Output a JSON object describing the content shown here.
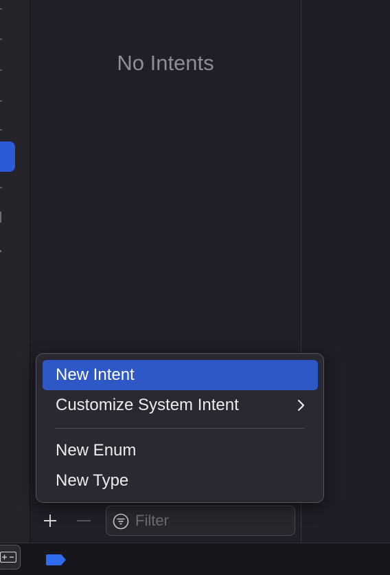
{
  "list": {
    "empty_label": "No Intents"
  },
  "add_menu": {
    "items": [
      {
        "label": "New Intent",
        "highlighted": true
      },
      {
        "label": "Customize System Intent",
        "has_submenu": true
      },
      {
        "label": "New Enum"
      },
      {
        "label": "New Type"
      }
    ]
  },
  "toolbar": {
    "add_icon": "plus-icon",
    "remove_icon": "minus-icon",
    "filter_icon": "filter-icon",
    "filter_placeholder": "Filter"
  },
  "colors": {
    "accent": "#2d58c6",
    "selection": "#2d5bd8",
    "background": "#1f1e27",
    "menu_background": "#2a2831"
  }
}
